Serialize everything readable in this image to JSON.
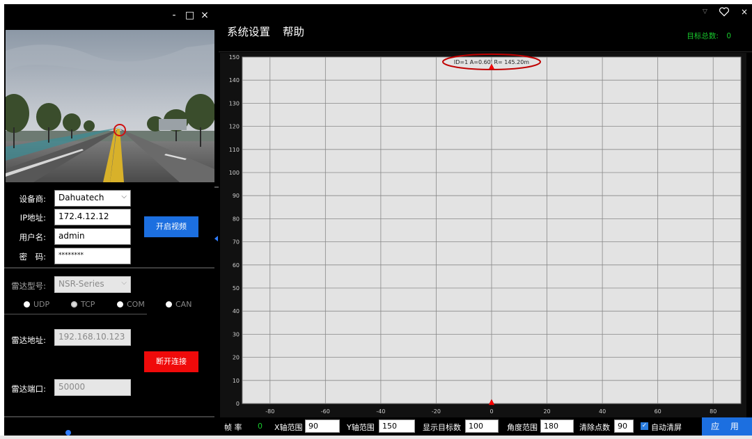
{
  "window": {
    "min": "-",
    "max": "□",
    "close": "×"
  },
  "device": {
    "vendor_label": "设备商:",
    "vendor_value": "Dahuatech",
    "ip_label": "IP地址:",
    "ip_value": "172.4.12.12",
    "user_label": "用户名:",
    "user_value": "admin",
    "pwd_label": "密　码:",
    "pwd_value": "********",
    "open_video_button": "开启视频"
  },
  "radar": {
    "model_label": "雷达型号:",
    "model_value": "NSR-Series",
    "protocols": [
      {
        "label": "UDP",
        "selected": false
      },
      {
        "label": "TCP",
        "selected": true
      },
      {
        "label": "COM",
        "selected": false
      },
      {
        "label": "CAN",
        "selected": false
      }
    ],
    "address_label": "雷达地址:",
    "address_value": "192.168.10.123",
    "port_label": "雷达端口:",
    "port_value": "50000",
    "disconnect_button": "断开连接"
  },
  "menu": {
    "system_settings": "系统设置",
    "help": "帮助"
  },
  "header": {
    "target_total_label": "目标总数:",
    "target_total_value": "0"
  },
  "chart_data": {
    "type": "scatter",
    "xlim": [
      -90,
      90
    ],
    "ylim": [
      0,
      150
    ],
    "x_ticks": [
      -80,
      -60,
      -40,
      -20,
      0,
      20,
      40,
      60,
      80
    ],
    "y_ticks": [
      0,
      10,
      20,
      30,
      40,
      50,
      60,
      70,
      80,
      90,
      100,
      110,
      120,
      130,
      140,
      150
    ],
    "grid": true,
    "background": "#e3e3e3",
    "points": [
      {
        "x": 0,
        "y": 145.2,
        "label": "ID=1 A=0.60' R= 145.20m",
        "highlighted": true
      },
      {
        "x": 0,
        "y": 0,
        "label": ""
      }
    ],
    "marker_color": "#ff0000",
    "highlight_color": "#c00000"
  },
  "bottom": {
    "frame_rate_label": "帧 率",
    "frame_rate_value": "0",
    "x_range_label": "X轴范围",
    "x_range_value": "90",
    "y_range_label": "Y轴范围",
    "y_range_value": "150",
    "show_targets_label": "显示目标数",
    "show_targets_value": "100",
    "angle_range_label": "角度范围",
    "angle_range_value": "180",
    "clear_points_label": "清除点数",
    "clear_points_value": "90",
    "auto_clear_label": "自动清屏",
    "auto_clear_checked": true,
    "apply_button": "应 用"
  },
  "colors": {
    "accent_blue": "#1c6fe0",
    "danger_red": "#f00a0a",
    "status_green": "#18c92d"
  }
}
